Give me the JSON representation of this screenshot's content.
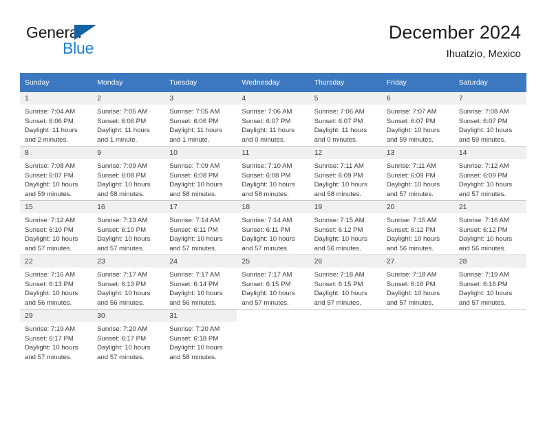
{
  "brand": {
    "line1": "General",
    "line2": "Blue",
    "accent_color": "#1a7fd4",
    "triangle_color": "#1464a5"
  },
  "header": {
    "title": "December 2024",
    "subtitle": "Ihuatzio, Mexico"
  },
  "calendar": {
    "header_color": "#3c78c0",
    "daynum_band_color": "#f0f0f0",
    "weekday_headers": [
      "Sunday",
      "Monday",
      "Tuesday",
      "Wednesday",
      "Thursday",
      "Friday",
      "Saturday"
    ],
    "weeks": [
      [
        {
          "day": "1",
          "sunrise": "Sunrise: 7:04 AM",
          "sunset": "Sunset: 6:06 PM",
          "daylight_line1": "Daylight: 11 hours",
          "daylight_line2": "and 2 minutes."
        },
        {
          "day": "2",
          "sunrise": "Sunrise: 7:05 AM",
          "sunset": "Sunset: 6:06 PM",
          "daylight_line1": "Daylight: 11 hours",
          "daylight_line2": "and 1 minute."
        },
        {
          "day": "3",
          "sunrise": "Sunrise: 7:05 AM",
          "sunset": "Sunset: 6:06 PM",
          "daylight_line1": "Daylight: 11 hours",
          "daylight_line2": "and 1 minute."
        },
        {
          "day": "4",
          "sunrise": "Sunrise: 7:06 AM",
          "sunset": "Sunset: 6:07 PM",
          "daylight_line1": "Daylight: 11 hours",
          "daylight_line2": "and 0 minutes."
        },
        {
          "day": "5",
          "sunrise": "Sunrise: 7:06 AM",
          "sunset": "Sunset: 6:07 PM",
          "daylight_line1": "Daylight: 11 hours",
          "daylight_line2": "and 0 minutes."
        },
        {
          "day": "6",
          "sunrise": "Sunrise: 7:07 AM",
          "sunset": "Sunset: 6:07 PM",
          "daylight_line1": "Daylight: 10 hours",
          "daylight_line2": "and 59 minutes."
        },
        {
          "day": "7",
          "sunrise": "Sunrise: 7:08 AM",
          "sunset": "Sunset: 6:07 PM",
          "daylight_line1": "Daylight: 10 hours",
          "daylight_line2": "and 59 minutes."
        }
      ],
      [
        {
          "day": "8",
          "sunrise": "Sunrise: 7:08 AM",
          "sunset": "Sunset: 6:07 PM",
          "daylight_line1": "Daylight: 10 hours",
          "daylight_line2": "and 59 minutes."
        },
        {
          "day": "9",
          "sunrise": "Sunrise: 7:09 AM",
          "sunset": "Sunset: 6:08 PM",
          "daylight_line1": "Daylight: 10 hours",
          "daylight_line2": "and 58 minutes."
        },
        {
          "day": "10",
          "sunrise": "Sunrise: 7:09 AM",
          "sunset": "Sunset: 6:08 PM",
          "daylight_line1": "Daylight: 10 hours",
          "daylight_line2": "and 58 minutes."
        },
        {
          "day": "11",
          "sunrise": "Sunrise: 7:10 AM",
          "sunset": "Sunset: 6:08 PM",
          "daylight_line1": "Daylight: 10 hours",
          "daylight_line2": "and 58 minutes."
        },
        {
          "day": "12",
          "sunrise": "Sunrise: 7:11 AM",
          "sunset": "Sunset: 6:09 PM",
          "daylight_line1": "Daylight: 10 hours",
          "daylight_line2": "and 58 minutes."
        },
        {
          "day": "13",
          "sunrise": "Sunrise: 7:11 AM",
          "sunset": "Sunset: 6:09 PM",
          "daylight_line1": "Daylight: 10 hours",
          "daylight_line2": "and 57 minutes."
        },
        {
          "day": "14",
          "sunrise": "Sunrise: 7:12 AM",
          "sunset": "Sunset: 6:09 PM",
          "daylight_line1": "Daylight: 10 hours",
          "daylight_line2": "and 57 minutes."
        }
      ],
      [
        {
          "day": "15",
          "sunrise": "Sunrise: 7:12 AM",
          "sunset": "Sunset: 6:10 PM",
          "daylight_line1": "Daylight: 10 hours",
          "daylight_line2": "and 57 minutes."
        },
        {
          "day": "16",
          "sunrise": "Sunrise: 7:13 AM",
          "sunset": "Sunset: 6:10 PM",
          "daylight_line1": "Daylight: 10 hours",
          "daylight_line2": "and 57 minutes."
        },
        {
          "day": "17",
          "sunrise": "Sunrise: 7:14 AM",
          "sunset": "Sunset: 6:11 PM",
          "daylight_line1": "Daylight: 10 hours",
          "daylight_line2": "and 57 minutes."
        },
        {
          "day": "18",
          "sunrise": "Sunrise: 7:14 AM",
          "sunset": "Sunset: 6:11 PM",
          "daylight_line1": "Daylight: 10 hours",
          "daylight_line2": "and 57 minutes."
        },
        {
          "day": "19",
          "sunrise": "Sunrise: 7:15 AM",
          "sunset": "Sunset: 6:12 PM",
          "daylight_line1": "Daylight: 10 hours",
          "daylight_line2": "and 56 minutes."
        },
        {
          "day": "20",
          "sunrise": "Sunrise: 7:15 AM",
          "sunset": "Sunset: 6:12 PM",
          "daylight_line1": "Daylight: 10 hours",
          "daylight_line2": "and 56 minutes."
        },
        {
          "day": "21",
          "sunrise": "Sunrise: 7:16 AM",
          "sunset": "Sunset: 6:12 PM",
          "daylight_line1": "Daylight: 10 hours",
          "daylight_line2": "and 56 minutes."
        }
      ],
      [
        {
          "day": "22",
          "sunrise": "Sunrise: 7:16 AM",
          "sunset": "Sunset: 6:13 PM",
          "daylight_line1": "Daylight: 10 hours",
          "daylight_line2": "and 56 minutes."
        },
        {
          "day": "23",
          "sunrise": "Sunrise: 7:17 AM",
          "sunset": "Sunset: 6:13 PM",
          "daylight_line1": "Daylight: 10 hours",
          "daylight_line2": "and 56 minutes."
        },
        {
          "day": "24",
          "sunrise": "Sunrise: 7:17 AM",
          "sunset": "Sunset: 6:14 PM",
          "daylight_line1": "Daylight: 10 hours",
          "daylight_line2": "and 56 minutes."
        },
        {
          "day": "25",
          "sunrise": "Sunrise: 7:17 AM",
          "sunset": "Sunset: 6:15 PM",
          "daylight_line1": "Daylight: 10 hours",
          "daylight_line2": "and 57 minutes."
        },
        {
          "day": "26",
          "sunrise": "Sunrise: 7:18 AM",
          "sunset": "Sunset: 6:15 PM",
          "daylight_line1": "Daylight: 10 hours",
          "daylight_line2": "and 57 minutes."
        },
        {
          "day": "27",
          "sunrise": "Sunrise: 7:18 AM",
          "sunset": "Sunset: 6:16 PM",
          "daylight_line1": "Daylight: 10 hours",
          "daylight_line2": "and 57 minutes."
        },
        {
          "day": "28",
          "sunrise": "Sunrise: 7:19 AM",
          "sunset": "Sunset: 6:16 PM",
          "daylight_line1": "Daylight: 10 hours",
          "daylight_line2": "and 57 minutes."
        }
      ],
      [
        {
          "day": "29",
          "sunrise": "Sunrise: 7:19 AM",
          "sunset": "Sunset: 6:17 PM",
          "daylight_line1": "Daylight: 10 hours",
          "daylight_line2": "and 57 minutes."
        },
        {
          "day": "30",
          "sunrise": "Sunrise: 7:20 AM",
          "sunset": "Sunset: 6:17 PM",
          "daylight_line1": "Daylight: 10 hours",
          "daylight_line2": "and 57 minutes."
        },
        {
          "day": "31",
          "sunrise": "Sunrise: 7:20 AM",
          "sunset": "Sunset: 6:18 PM",
          "daylight_line1": "Daylight: 10 hours",
          "daylight_line2": "and 58 minutes."
        },
        {
          "day": "",
          "sunrise": "",
          "sunset": "",
          "daylight_line1": "",
          "daylight_line2": ""
        },
        {
          "day": "",
          "sunrise": "",
          "sunset": "",
          "daylight_line1": "",
          "daylight_line2": ""
        },
        {
          "day": "",
          "sunrise": "",
          "sunset": "",
          "daylight_line1": "",
          "daylight_line2": ""
        },
        {
          "day": "",
          "sunrise": "",
          "sunset": "",
          "daylight_line1": "",
          "daylight_line2": ""
        }
      ]
    ]
  }
}
